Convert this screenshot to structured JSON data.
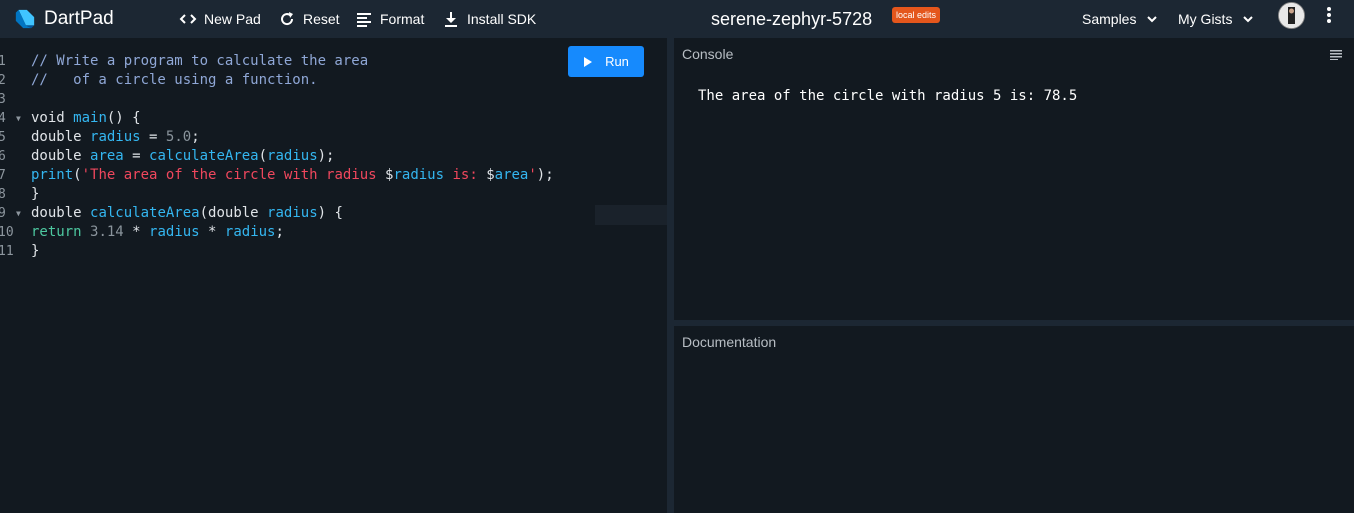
{
  "header": {
    "app_name": "DartPad",
    "new_pad": "New Pad",
    "reset": "Reset",
    "format": "Format",
    "install_sdk": "Install SDK",
    "pad_title": "serene-zephyr-5728",
    "badge": "local edits",
    "samples": "Samples",
    "my_gists": "My Gists"
  },
  "editor": {
    "run_label": "Run",
    "line_numbers": [
      "1",
      "2",
      "3",
      "4",
      "5",
      "6",
      "7",
      "8",
      "9",
      "10",
      "11"
    ],
    "lines": [
      "// Write a program to calculate the area",
      "//   of a circle using a function.",
      "",
      "void main() {",
      "double radius = 5.0;",
      "double area = calculateArea(radius);",
      "print('The area of the circle with radius $radius is: $area');",
      "}",
      "double calculateArea(double radius) {",
      "return 3.14 * radius * radius;",
      "}"
    ]
  },
  "console": {
    "title": "Console",
    "output": "The area of the circle with radius 5 is: 78.5"
  },
  "documentation": {
    "title": "Documentation"
  },
  "colors": {
    "accent": "#168afd",
    "badge": "#e4561c"
  }
}
